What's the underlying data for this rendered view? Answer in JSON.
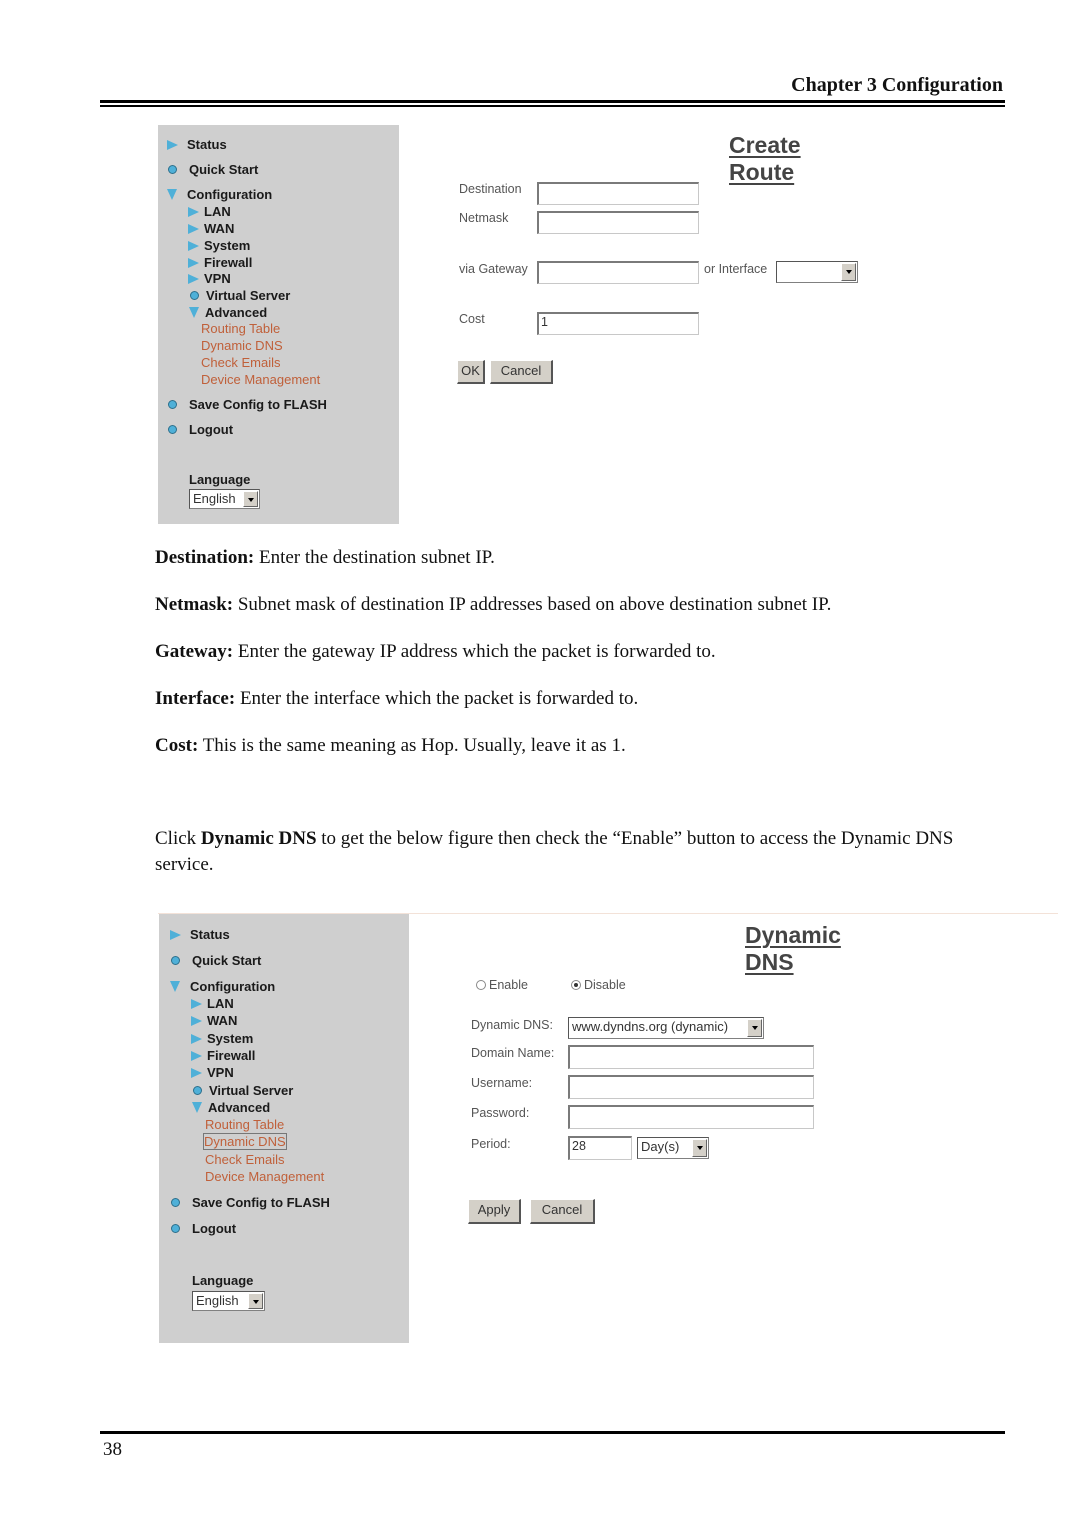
{
  "header": {
    "chapter_title": "Chapter 3 Configuration"
  },
  "screenshot1": {
    "sidebar": {
      "items": [
        {
          "label": "Status",
          "icon": "triangle-right-icon"
        },
        {
          "label": "Quick Start",
          "icon": "circle-icon"
        },
        {
          "label": "Configuration",
          "icon": "triangle-down-icon"
        },
        {
          "label": "LAN",
          "icon": "triangle-right-icon"
        },
        {
          "label": "WAN",
          "icon": "triangle-right-icon"
        },
        {
          "label": "System",
          "icon": "triangle-right-icon"
        },
        {
          "label": "Firewall",
          "icon": "triangle-right-icon"
        },
        {
          "label": "VPN",
          "icon": "triangle-right-icon"
        },
        {
          "label": "Virtual Server",
          "icon": "circle-icon"
        },
        {
          "label": "Advanced",
          "icon": "triangle-down-icon"
        },
        {
          "label": "Save Config to FLASH",
          "icon": "circle-icon"
        },
        {
          "label": "Logout",
          "icon": "circle-icon"
        }
      ],
      "advanced_links": [
        "Routing Table",
        "Dynamic DNS",
        "Check Emails",
        "Device Management"
      ],
      "language_label": "Language",
      "language_value": "English"
    },
    "form": {
      "title": "Create Route",
      "destination_label": "Destination",
      "destination_value": "",
      "netmask_label": "Netmask",
      "netmask_value": "",
      "gateway_label": "via Gateway",
      "gateway_value": "",
      "interface_label": "or Interface",
      "interface_value": "",
      "cost_label": "Cost",
      "cost_value": "1",
      "ok_label": "OK",
      "cancel_label": "Cancel"
    }
  },
  "descriptions": [
    {
      "term": "Destination:",
      "text": " Enter the destination subnet IP."
    },
    {
      "term": "Netmask:",
      "text": " Subnet mask of destination IP addresses based on above destination subnet IP."
    },
    {
      "term": "Gateway:",
      "text": " Enter the gateway IP address which the packet is forwarded to."
    },
    {
      "term": "Interface:",
      "text": " Enter the interface which the packet is forwarded to."
    },
    {
      "term": "Cost:",
      "text": " This is the same meaning as Hop. Usually, leave it as 1."
    }
  ],
  "intro": {
    "prefix": "Click ",
    "bold": "Dynamic DNS",
    "suffix": " to get the below figure then check the “Enable” button to access the Dynamic DNS service."
  },
  "screenshot2": {
    "sidebar": {
      "items": [
        {
          "label": "Status",
          "icon": "triangle-right-icon"
        },
        {
          "label": "Quick Start",
          "icon": "circle-icon"
        },
        {
          "label": "Configuration",
          "icon": "triangle-down-icon"
        },
        {
          "label": "LAN",
          "icon": "triangle-right-icon"
        },
        {
          "label": "WAN",
          "icon": "triangle-right-icon"
        },
        {
          "label": "System",
          "icon": "triangle-right-icon"
        },
        {
          "label": "Firewall",
          "icon": "triangle-right-icon"
        },
        {
          "label": "VPN",
          "icon": "triangle-right-icon"
        },
        {
          "label": "Virtual Server",
          "icon": "circle-icon"
        },
        {
          "label": "Advanced",
          "icon": "triangle-down-icon"
        },
        {
          "label": "Save Config to FLASH",
          "icon": "circle-icon"
        },
        {
          "label": "Logout",
          "icon": "circle-icon"
        }
      ],
      "advanced_links": [
        "Routing Table",
        "Dynamic DNS",
        "Check Emails",
        "Device Management"
      ],
      "active_link": "Dynamic DNS",
      "language_label": "Language",
      "language_value": "English"
    },
    "form": {
      "title": "Dynamic DNS",
      "enable_label": "Enable",
      "disable_label": "Disable",
      "selected": "Disable",
      "provider_label": "Dynamic DNS:",
      "provider_value": "www.dyndns.org (dynamic)",
      "domain_label": "Domain Name:",
      "domain_value": "",
      "username_label": "Username:",
      "username_value": "",
      "password_label": "Password:",
      "password_value": "",
      "period_label": "Period:",
      "period_value": "28",
      "period_unit": "Day(s)",
      "apply_label": "Apply",
      "cancel_label": "Cancel"
    }
  },
  "footer": {
    "page_number": "38"
  }
}
